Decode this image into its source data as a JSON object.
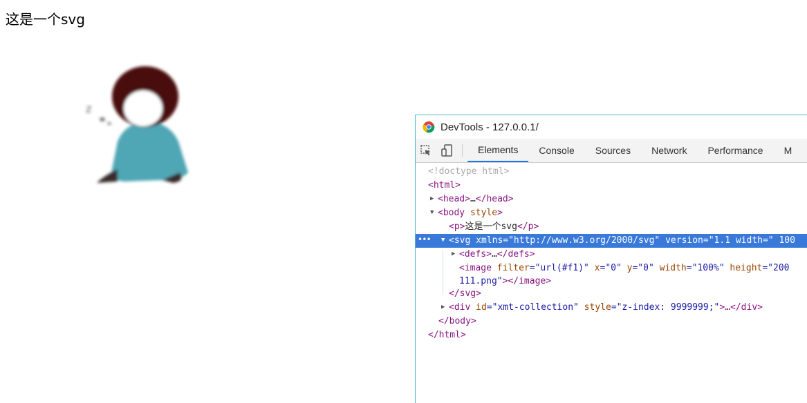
{
  "page": {
    "paragraph": "这是一个svg"
  },
  "devtools": {
    "title": "DevTools - 127.0.0.1/",
    "tabs": [
      "Elements",
      "Console",
      "Sources",
      "Network",
      "Performance",
      "M"
    ],
    "active_tab": "Elements",
    "icons": [
      "chrome-logo-icon",
      "inspect-element-icon",
      "device-toolbar-icon",
      "more-dots-icon"
    ]
  },
  "dom": {
    "l1": "<!doctype html>",
    "l2": "<html>",
    "l3_open": "<head>",
    "l3_ellipsis": "…",
    "l3_close": "</head>",
    "l4_open": "<body",
    "l4_attr": " style",
    "l4_end": ">",
    "l5_open": "<p>",
    "l5_text": "这是一个svg",
    "l5_close": "</p>",
    "l6_open": "<svg",
    "l6_a1": " xmlns",
    "l6_v1": "=\"http://www.w3.org/2000/svg\"",
    "l6_a2": " version",
    "l6_v2": "=\"1.1 width=\" 100",
    "l7_open": "<defs>",
    "l7_ellipsis": "…",
    "l7_close": "</defs>",
    "l8_open": "<image",
    "l8_a1": " filter",
    "l8_v1": "=\"url(#f1)\"",
    "l8_a2": " x",
    "l8_v2": "=\"0\"",
    "l8_a3": " y",
    "l8_v3": "=\"0\"",
    "l8_a4": " width",
    "l8_v4": "=\"100%\"",
    "l8_a5": " height",
    "l8_v5": "=\"200",
    "l9_val": "111.png\"",
    "l9_tag": "></image>",
    "l10": "</svg>",
    "l11_open": "<div",
    "l11_a1": " id",
    "l11_v1": "=\"xmt-collection\"",
    "l11_a2": " style",
    "l11_v2": "=\"z-index: 9999999;\"",
    "l11_end": ">…</div>",
    "l12": "</body>",
    "l13": "</html>",
    "dots": "•••"
  }
}
